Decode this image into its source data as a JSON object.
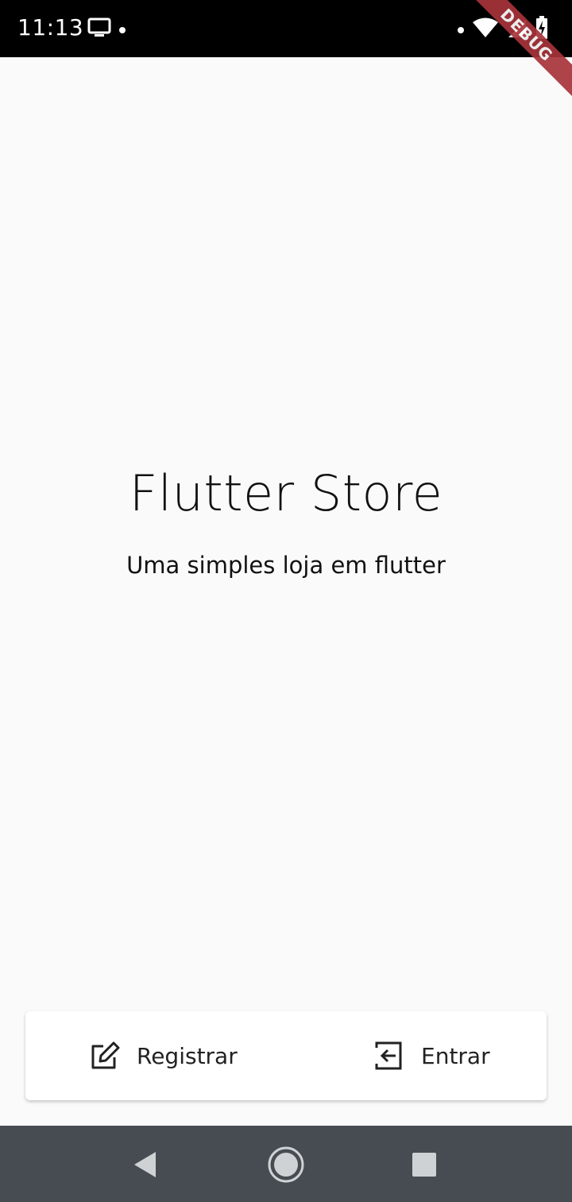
{
  "status_bar": {
    "time": "11:13",
    "icons": [
      "display-icon",
      "notification-dot-icon",
      "wifi-icon",
      "signal-icon",
      "battery-charging-icon"
    ]
  },
  "debug_banner": {
    "label": "DEBUG",
    "color": "#a8343b"
  },
  "hero": {
    "title": "Flutter Store",
    "subtitle": "Uma simples loja em flutter"
  },
  "actions": {
    "register": {
      "label": "Registrar",
      "icon": "edit-icon"
    },
    "enter": {
      "label": "Entrar",
      "icon": "login-icon"
    }
  },
  "nav_bar": {
    "buttons": [
      "back-icon",
      "home-icon",
      "recent-apps-icon"
    ],
    "color": "#464c52"
  }
}
